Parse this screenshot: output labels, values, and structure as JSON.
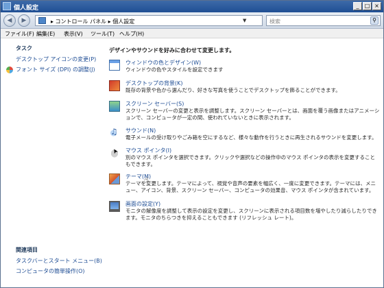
{
  "window": {
    "title": "個人設定"
  },
  "address": {
    "crumbs": "▸ コントロール パネル ▸ 個人設定"
  },
  "search": {
    "placeholder": "検索"
  },
  "menu": [
    "ファイル(F)",
    "編集(E)",
    "表示(V)",
    "ツール(T)",
    "ヘルプ(H)"
  ],
  "sidebar": {
    "tasks_heading": "タスク",
    "tasks": [
      "デスクトップ アイコンの変更(P)",
      "フォント サイズ (DPI) の調整(J)"
    ],
    "related_heading": "関連項目",
    "related": [
      "タスクバーとスタート メニュー(B)",
      "コンピュータの簡単操作(O)"
    ]
  },
  "main": {
    "header": "デザインやサウンドを好みに合わせて変更します。",
    "items": [
      {
        "label": "ウィンドウの色とデザイン(W)",
        "desc": "ウィンドウの色やスタイルを設定できます",
        "icon": "window-color-icon"
      },
      {
        "label": "デスクトップの背景(K)",
        "desc": "既存の背景や色から選んだり、好きな写真を使うことでデスクトップを飾ることができます。",
        "icon": "desktop-background-icon"
      },
      {
        "label": "スクリーン セーバー(S)",
        "desc": "スクリーン セーバーの変更と表示を調整します。スクリーン セーバーとは、画面を覆う画像またはアニメーションで、コンピュータが一定の間、使われていないときに表示されます。",
        "icon": "screensaver-icon"
      },
      {
        "label": "サウンド(N)",
        "desc": "電子メールの受け取りやごみ箱を空にするなど、様々な動作を行うときに再生されるサウンドを変更します。",
        "icon": "sound-icon"
      },
      {
        "label": "マウス ポインタ(I)",
        "desc": "別のマウス ポインタを選択できます。クリックや選択などの操作中のマウス ポインタの表示を変更することもできます。",
        "icon": "mouse-pointer-icon"
      },
      {
        "label": "テーマ(M)",
        "desc": "テーマを変更します。テーマによって、視覚や音声の要素を幅広く、一度に変更できます。テーマには、メニュー、アイコン、背景、スクリーン セーバー、コンピュータの効果音、マウス ポインタが含まれています。",
        "icon": "theme-icon"
      },
      {
        "label": "画面の設定(Y)",
        "desc": "モニタの解像度を調整して表示の設定を変更し、スクリーンに表示される項目数を増やしたり減らしたりできます。モニタのちらつきを抑えることもできます (リフレッシュ レート)。",
        "icon": "display-settings-icon"
      }
    ]
  }
}
